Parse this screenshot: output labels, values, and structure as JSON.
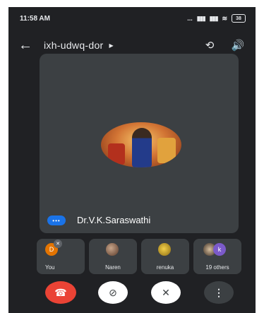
{
  "status_bar": {
    "time": "11:58 AM",
    "icons": [
      "dots-icon",
      "sim-signal-icon",
      "cellular-signal-icon",
      "wifi-icon",
      "battery-icon"
    ],
    "dots": "...",
    "signal_a": "▮▮▮",
    "signal_b": "▮▮▮",
    "wifi": "≋",
    "battery": "38"
  },
  "header": {
    "meeting_code": "ixh-udwq-dor",
    "back_glyph": "←",
    "caret_glyph": "▶",
    "switch_camera_glyph": "⟲",
    "speaker_glyph": "🔊"
  },
  "main_speaker": {
    "name": "Dr.V.K.Saraswathi",
    "indicator_glyph": "•••"
  },
  "participants": [
    {
      "label": "You",
      "avatar_letter": "D",
      "muted_glyph": "✕"
    },
    {
      "label": "Naren"
    },
    {
      "label": "renuka"
    },
    {
      "label": "19 others",
      "avatar_letter": "k"
    }
  ],
  "controls": {
    "end_call_glyph": "☎",
    "camera_off_glyph": "⊘",
    "mic_off_glyph": "✕",
    "more_glyph": "⋮"
  },
  "colors": {
    "background": "#202124",
    "tile": "#3c4043",
    "end_call": "#ea4335",
    "speaking_indicator": "#1a73e8",
    "you_avatar": "#e37400",
    "others_avatar": "#7b5ac9"
  }
}
